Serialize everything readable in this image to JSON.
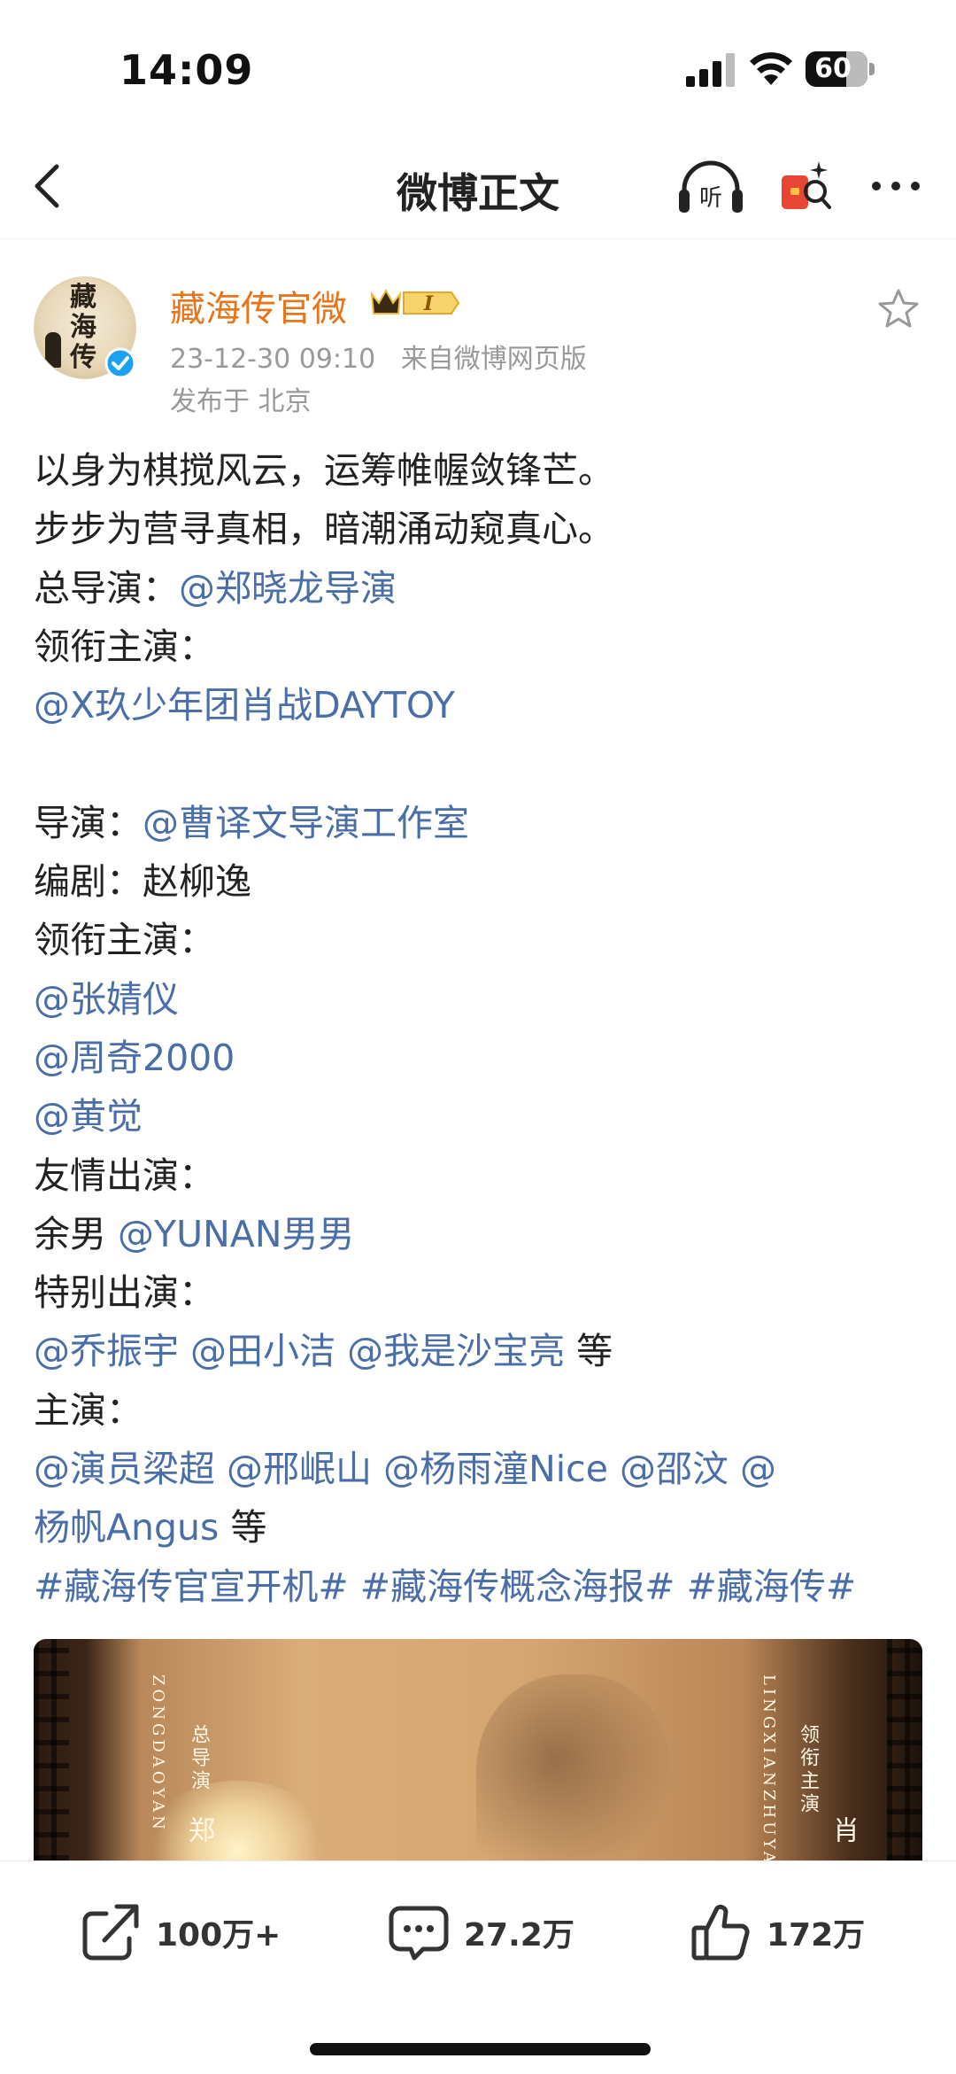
{
  "status_bar": {
    "time": "14:09",
    "battery": "60"
  },
  "nav": {
    "title": "微博正文",
    "listen_label": "听"
  },
  "post": {
    "author": "藏海传官微",
    "badge_level": "I",
    "avatar_text": "藏海传",
    "timestamp": "23-12-30 09:10",
    "source": "来自微博网页版",
    "location": "发布于 北京",
    "lines": [
      [
        {
          "t": "以身为棋搅风云，运筹帷幄敛锋芒。"
        }
      ],
      [
        {
          "t": "步步为营寻真相，暗潮涌动窥真心。"
        }
      ],
      [
        {
          "t": "总导演："
        },
        {
          "t": "@郑晓龙导演",
          "m": true
        }
      ],
      [
        {
          "t": "领衔主演："
        }
      ],
      [
        {
          "t": "@X玖少年团肖战DAYTOY",
          "m": true
        }
      ],
      [
        {
          "t": ""
        }
      ],
      [
        {
          "t": "导演："
        },
        {
          "t": "@曹译文导演工作室",
          "m": true
        }
      ],
      [
        {
          "t": "编剧：赵柳逸"
        }
      ],
      [
        {
          "t": "领衔主演："
        }
      ],
      [
        {
          "t": "@张婧仪",
          "m": true
        }
      ],
      [
        {
          "t": "@周奇2000",
          "m": true
        }
      ],
      [
        {
          "t": "@黄觉",
          "m": true
        }
      ],
      [
        {
          "t": "友情出演："
        }
      ],
      [
        {
          "t": "余男 "
        },
        {
          "t": "@YUNAN男男",
          "m": true
        }
      ],
      [
        {
          "t": "特别出演："
        }
      ],
      [
        {
          "t": "@乔振宇",
          "m": true
        },
        {
          "t": " "
        },
        {
          "t": "@田小洁",
          "m": true
        },
        {
          "t": " "
        },
        {
          "t": "@我是沙宝亮",
          "m": true
        },
        {
          "t": " 等"
        }
      ],
      [
        {
          "t": "主演："
        }
      ],
      [
        {
          "t": "@演员梁超",
          "m": true
        },
        {
          "t": " "
        },
        {
          "t": "@邢岷山",
          "m": true
        },
        {
          "t": " "
        },
        {
          "t": "@杨雨潼Nice",
          "m": true
        },
        {
          "t": " "
        },
        {
          "t": "@邵汶",
          "m": true
        },
        {
          "t": " "
        },
        {
          "t": "@",
          "m": true
        }
      ],
      [
        {
          "t": "杨帆Angus",
          "m": true
        },
        {
          "t": " 等"
        }
      ],
      [
        {
          "t": "#藏海传官宣开机#",
          "m": true
        },
        {
          "t": " "
        },
        {
          "t": "#藏海传概念海报#",
          "m": true
        },
        {
          "t": " "
        },
        {
          "t": "#藏海传#",
          "m": true
        }
      ]
    ],
    "poster": {
      "left_vertical_pinyin": "ZONGDAOYAN",
      "left_vertical_cn": "总导演",
      "left_name": "郑",
      "right_vertical_pinyin": "LINGXIANZHUYAN",
      "right_vertical_cn": "领衔主演",
      "right_name": "肖"
    }
  },
  "actions": {
    "repost_count": "100万+",
    "comment_count": "27.2万",
    "like_count": "172万"
  },
  "colors": {
    "mention": "#4a6ea8",
    "username": "#e8751a",
    "meta": "#999999"
  }
}
